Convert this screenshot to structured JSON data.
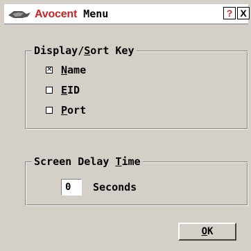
{
  "window": {
    "brand": "Avocent",
    "title": " Menu",
    "help_label": "?",
    "close_label": "X",
    "brand_color": "#cc2222"
  },
  "display_sort": {
    "legend_pre": "Display/",
    "legend_underlined": "S",
    "legend_post": "ort Key",
    "options": [
      {
        "key": "N",
        "rest": "ame",
        "checked": true
      },
      {
        "key": "E",
        "rest": "ID",
        "checked": false
      },
      {
        "key": "P",
        "rest": "ort",
        "checked": false
      }
    ]
  },
  "screen_delay": {
    "legend_pre": "Screen Delay ",
    "legend_underlined": "T",
    "legend_post": "ime",
    "value": "0",
    "unit": "Seconds"
  },
  "ok_button": {
    "key": "O",
    "rest": "K"
  },
  "icons": {
    "logo": "avocent-logo-icon",
    "checkmark": "⊠"
  }
}
